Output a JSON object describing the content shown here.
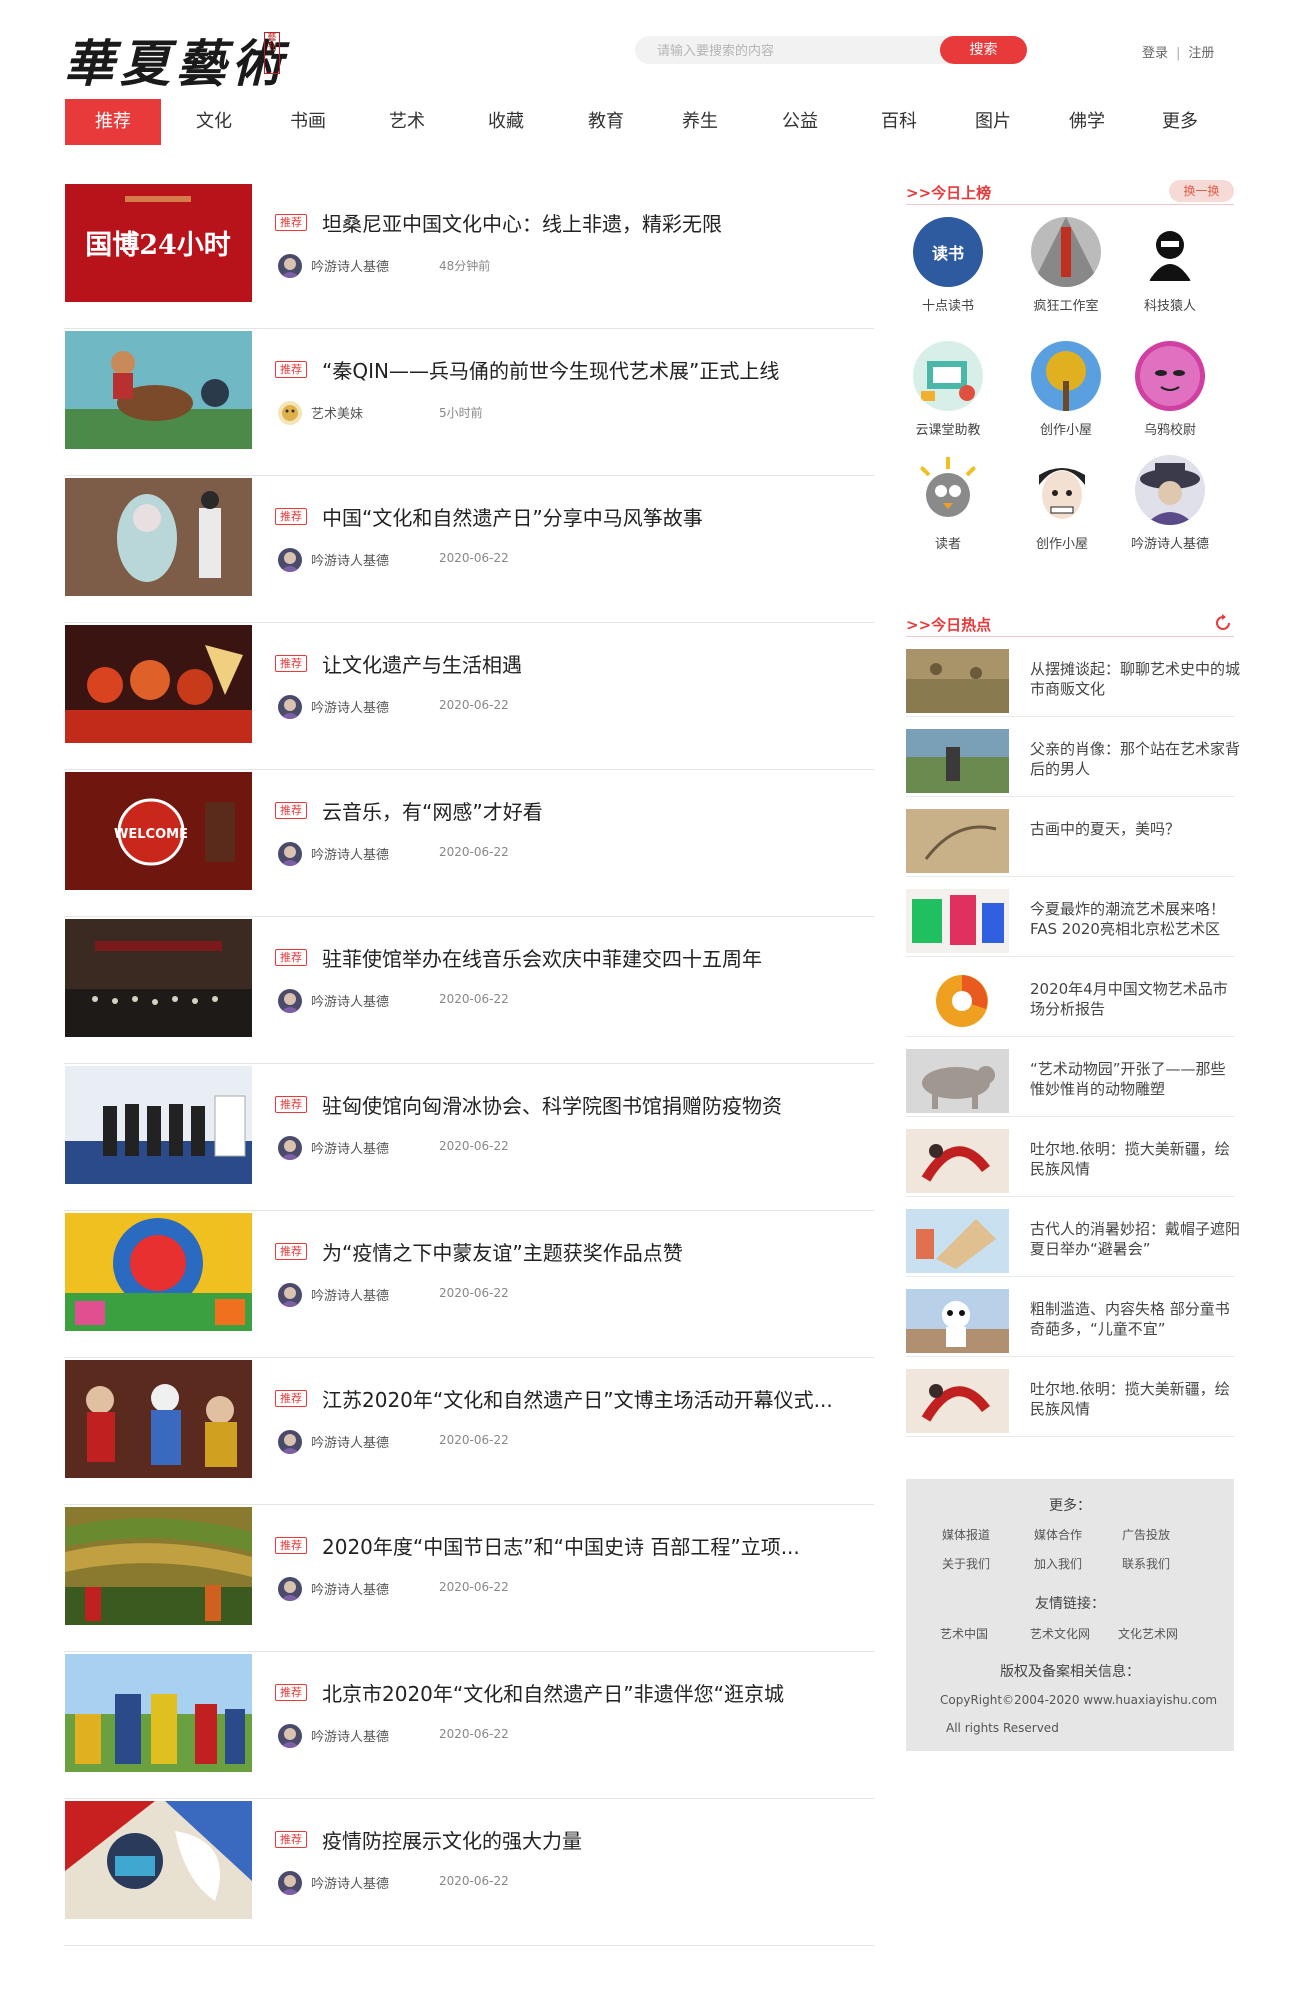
{
  "header": {
    "logo_text": "華夏藝術",
    "logo_seal": "藝刊",
    "search_placeholder": "请输入要搜索的内容",
    "search_button": "搜索",
    "login": "登录",
    "separator": "|",
    "register": "注册"
  },
  "nav": [
    "推荐",
    "文化",
    "书画",
    "艺术",
    "收藏",
    "教育",
    "养生",
    "公益",
    "百科",
    "图片",
    "佛学",
    "更多"
  ],
  "badge_label": "推荐",
  "articles": [
    {
      "title": "坦桑尼亚中国文化中心：线上非遗，精彩无限",
      "author": "吟游诗人基德",
      "time": "48分钟前",
      "thumb_text": "国博24小时"
    },
    {
      "title": "“秦QIN——兵马俑的前世今生现代艺术展”正式上线",
      "author": "艺术美妹",
      "time": "5小时前"
    },
    {
      "title": "中国“文化和自然遗产日”分享中马风筝故事",
      "author": "吟游诗人基德",
      "time": "2020-06-22"
    },
    {
      "title": "让文化遗产与生活相遇",
      "author": "吟游诗人基德",
      "time": "2020-06-22"
    },
    {
      "title": "云音乐，有“网感”才好看",
      "author": "吟游诗人基德",
      "time": "2020-06-22",
      "thumb_text": "WELCOME"
    },
    {
      "title": "驻菲使馆举办在线音乐会欢庆中菲建交四十五周年",
      "author": "吟游诗人基德",
      "time": "2020-06-22"
    },
    {
      "title": "驻匈使馆向匈滑冰协会、科学院图书馆捐赠防疫物资",
      "author": "吟游诗人基德",
      "time": "2020-06-22"
    },
    {
      "title": "为“疫情之下中蒙友谊”主题获奖作品点赞",
      "author": "吟游诗人基德",
      "time": "2020-06-22"
    },
    {
      "title": "江苏2020年“文化和自然遗产日”文博主场活动开幕仪式...",
      "author": "吟游诗人基德",
      "time": "2020-06-22"
    },
    {
      "title": "2020年度“中国节日志”和“中国史诗 百部工程”立项...",
      "author": "吟游诗人基德",
      "time": "2020-06-22"
    },
    {
      "title": "北京市2020年“文化和自然遗产日”非遗伴您“逛京城",
      "author": "吟游诗人基德",
      "time": "2020-06-22"
    },
    {
      "title": "疫情防控展示文化的强大力量",
      "author": "吟游诗人基德",
      "time": "2020-06-22"
    }
  ],
  "sidebar": {
    "top_title": ">>今日上榜",
    "refresh_label": "换一换",
    "top_people": [
      {
        "name": "十点读书",
        "avatar_text": "读书"
      },
      {
        "name": "疯狂工作室"
      },
      {
        "name": "科技猿人"
      },
      {
        "name": "云课堂助教"
      },
      {
        "name": "创作小屋"
      },
      {
        "name": "乌鸦校尉"
      },
      {
        "name": "读者"
      },
      {
        "name": "创作小屋"
      },
      {
        "name": "吟游诗人基德"
      }
    ],
    "hot_title": ">>今日热点",
    "hot_items": [
      "从摆摊谈起：聊聊艺术史中的城市商贩文化",
      "父亲的肖像：那个站在艺术家背后的男人",
      "古画中的夏天，美吗？",
      "今夏最炸的潮流艺术展来咯！FAS 2020亮相北京松艺术区",
      "2020年4月中国文物艺术品市场分析报告",
      "“艺术动物园”开张了——那些惟妙惟肖的动物雕塑",
      "吐尔地.依明：揽大美新疆，绘民族风情",
      "古代人的消暑妙招：戴帽子遮阳 夏日举办“避暑会”",
      "粗制滥造、内容失格 部分童书奇葩多，“儿童不宜”",
      "吐尔地.依明：揽大美新疆，绘民族风情"
    ]
  },
  "footer": {
    "more_title": "更多：",
    "more_links": [
      "媒体报道",
      "媒体合作",
      "广告投放",
      "关于我们",
      "加入我们",
      "联系我们"
    ],
    "friend_title": "友情链接：",
    "friend_links": [
      "艺术中国",
      "艺术文化网",
      "文化艺术网"
    ],
    "copyright_title": "版权及备案相关信息：",
    "copyright": "CopyRight©2004-2020 www.huaxiayishu.com",
    "rights": "All rights Reserved"
  },
  "colors": {
    "accent": "#e83a3a",
    "badge_bg": "#f6dad6"
  }
}
